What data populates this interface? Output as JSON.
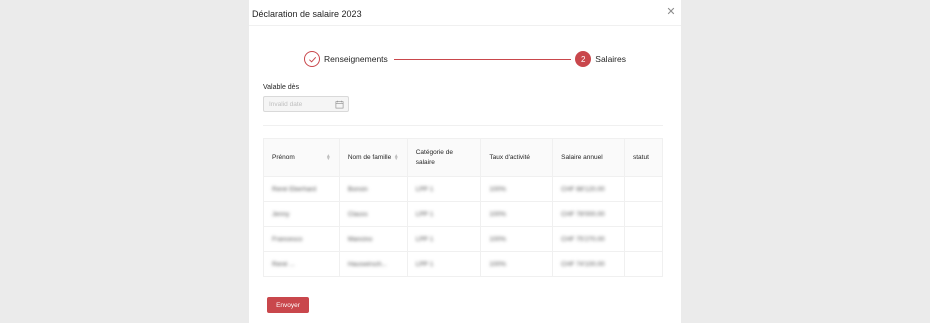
{
  "modal": {
    "title": "Déclaration de salaire 2023",
    "close_icon": "close-icon"
  },
  "steps": [
    {
      "label": "Renseignements",
      "status": "done",
      "icon": "check-icon"
    },
    {
      "label": "Salaires",
      "status": "current",
      "number": "2"
    }
  ],
  "form": {
    "valid_from_label": "Valable dès",
    "date_placeholder": "Invalid date",
    "calendar_icon": "calendar-icon"
  },
  "table": {
    "columns": [
      "Prénom",
      "Nom de famille",
      "Catégorie de salaire",
      "Taux d'activité",
      "Salaire annuel",
      "statut"
    ],
    "rows": [
      [
        "René Eberhard",
        "Bonsin",
        "LPP 1",
        "100%",
        "CHF 88'120.00",
        ""
      ],
      [
        "Jenny",
        "Clauss",
        "LPP 1",
        "100%",
        "CHF 78'000.00",
        ""
      ],
      [
        "Francesco",
        "Mancino",
        "LPP 1",
        "100%",
        "CHF 75'270.00",
        ""
      ],
      [
        "René ...",
        "Hauswirsch...",
        "LPP 1",
        "100%",
        "CHF 74'100.00",
        ""
      ]
    ]
  },
  "actions": {
    "submit_label": "Envoyer"
  },
  "colors": {
    "accent": "#c9474c",
    "backdrop": "#ebebeb"
  }
}
